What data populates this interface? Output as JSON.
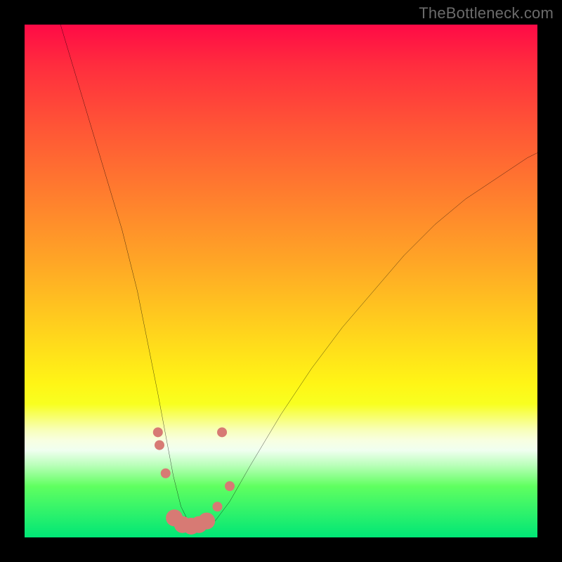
{
  "watermark": {
    "text": "TheBottleneck.com"
  },
  "chart_data": {
    "type": "line",
    "title": "",
    "xlabel": "",
    "ylabel": "",
    "xlim": [
      0,
      100
    ],
    "ylim": [
      0,
      100
    ],
    "grid": false,
    "legend": false,
    "background": {
      "style": "vertical-gradient",
      "meaning": "green=good / red=bad",
      "stops": [
        {
          "pos": 0.0,
          "color": "#ff0a46"
        },
        {
          "pos": 0.33,
          "color": "#ff7d2e"
        },
        {
          "pos": 0.7,
          "color": "#fff516"
        },
        {
          "pos": 0.83,
          "color": "#f0fff0"
        },
        {
          "pos": 1.0,
          "color": "#00e676"
        }
      ]
    },
    "series": [
      {
        "name": "bottleneck-curve",
        "stroke": "#000000",
        "x": [
          7,
          10,
          13,
          16,
          19,
          22,
          24,
          26,
          27.5,
          29,
          30.5,
          32,
          33.5,
          35,
          37,
          40,
          44,
          50,
          56,
          62,
          68,
          74,
          80,
          86,
          92,
          98,
          100
        ],
        "y": [
          100,
          90,
          80,
          70,
          60,
          48,
          38,
          28,
          20,
          12,
          6,
          3,
          2,
          2,
          3,
          7,
          14,
          24,
          33,
          41,
          48,
          55,
          61,
          66,
          70,
          74,
          75
        ]
      }
    ],
    "markers": {
      "name": "highlight-dots",
      "color": "#d77a74",
      "radius_small": 7,
      "radius_large": 12,
      "points": [
        {
          "x": 26.0,
          "y": 20.5,
          "r": "small"
        },
        {
          "x": 26.3,
          "y": 18.0,
          "r": "small"
        },
        {
          "x": 27.5,
          "y": 12.5,
          "r": "small"
        },
        {
          "x": 29.2,
          "y": 3.8,
          "r": "large"
        },
        {
          "x": 30.8,
          "y": 2.5,
          "r": "large"
        },
        {
          "x": 32.5,
          "y": 2.2,
          "r": "large"
        },
        {
          "x": 34.0,
          "y": 2.5,
          "r": "large"
        },
        {
          "x": 35.5,
          "y": 3.2,
          "r": "large"
        },
        {
          "x": 37.6,
          "y": 6.0,
          "r": "small"
        },
        {
          "x": 40.0,
          "y": 10.0,
          "r": "small"
        },
        {
          "x": 38.5,
          "y": 20.5,
          "r": "small"
        }
      ]
    }
  }
}
